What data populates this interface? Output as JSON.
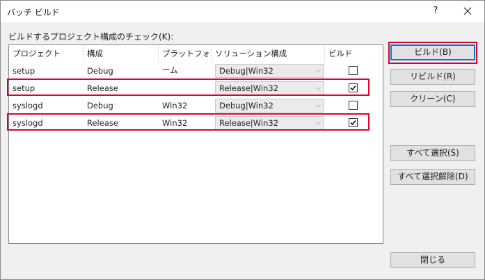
{
  "window": {
    "title": "バッチ ビルド",
    "help_label": "?"
  },
  "caption": "ビルドするプロジェクト構成のチェック(K):",
  "columns": [
    "プロジェクト",
    "構成",
    "プラットフォーム",
    "ソリューション構成",
    "ビルド"
  ],
  "rows": [
    {
      "project": "setup",
      "config": "Debug",
      "platform": "",
      "solution_config": "Debug|Win32",
      "build": false
    },
    {
      "project": "setup",
      "config": "Release",
      "platform": "",
      "solution_config": "Release|Win32",
      "build": true
    },
    {
      "project": "syslogd",
      "config": "Debug",
      "platform": "Win32",
      "solution_config": "Debug|Win32",
      "build": false
    },
    {
      "project": "syslogd",
      "config": "Release",
      "platform": "Win32",
      "solution_config": "Release|Win32",
      "build": true
    }
  ],
  "buttons": {
    "build": "ビルド(B)",
    "rebuild": "リビルド(R)",
    "clean": "クリーン(C)",
    "select_all": "すべて選択(S)",
    "deselect_all": "すべて選択解除(D)",
    "close": "閉じる"
  },
  "highlight_color": "#e0002a",
  "accent_color": "#0078d7"
}
